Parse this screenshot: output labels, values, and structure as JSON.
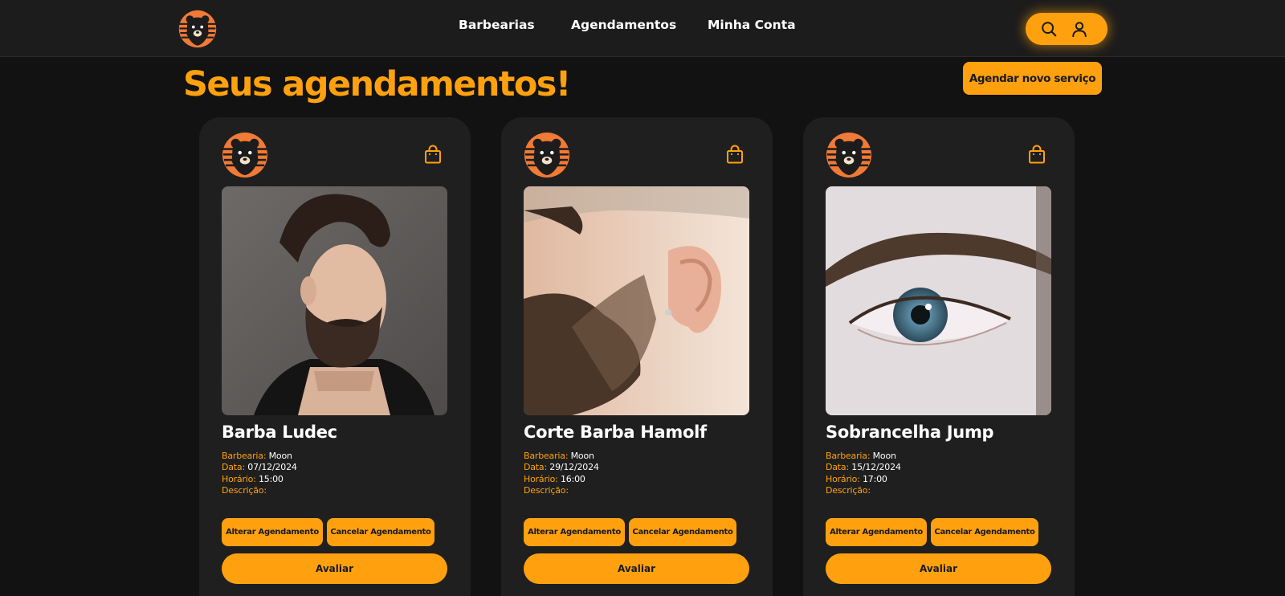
{
  "nav": {
    "links": [
      "Barbearias",
      "Agendamentos",
      "Minha Conta"
    ],
    "accent": "#ffa10f"
  },
  "page": {
    "title": "Seus agendamentos!",
    "new_button": "Agendar novo serviço"
  },
  "labels": {
    "barbearia": "Barbearia:",
    "data": "Data:",
    "horario": "Horário:",
    "descricao": "Descrição:",
    "alter": "Alterar Agendamento",
    "cancel": "Cancelar Agendamento",
    "rate": "Avaliar"
  },
  "cards": [
    {
      "name": "Barba Ludec",
      "barbearia": "Moon",
      "data": "07/12/2024",
      "horario": "15:00",
      "descricao": ""
    },
    {
      "name": "Corte Barba Hamolf",
      "barbearia": "Moon",
      "data": "29/12/2024",
      "horario": "16:00",
      "descricao": ""
    },
    {
      "name": "Sobrancelha Jump",
      "barbearia": "Moon",
      "data": "15/12/2024",
      "horario": "17:00",
      "descricao": ""
    }
  ]
}
